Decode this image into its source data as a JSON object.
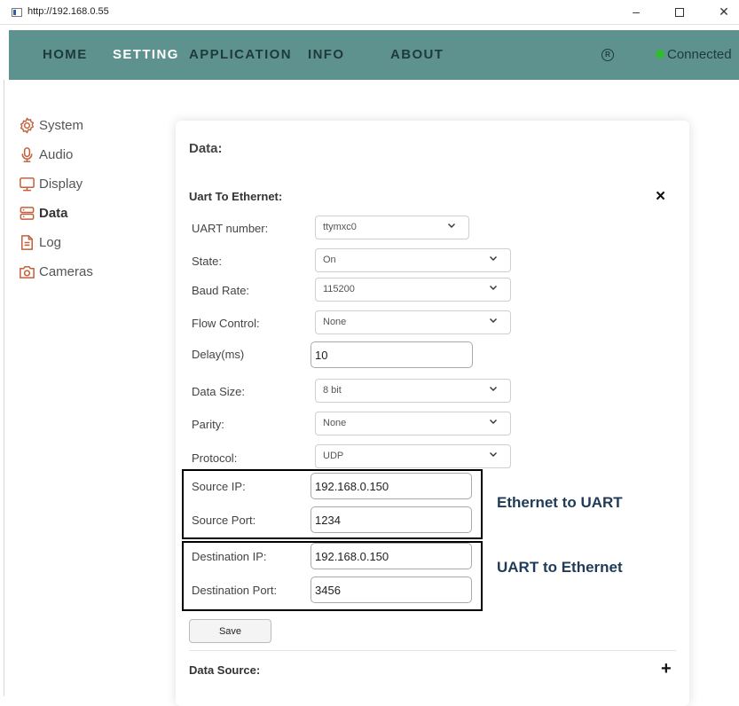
{
  "window": {
    "url": "http://192.168.0.55",
    "minimize": "–",
    "close": "✕"
  },
  "nav": {
    "items": [
      "HOME",
      "SETTING",
      "APPLICATION",
      "INFO",
      "ABOUT"
    ],
    "active": "SETTING",
    "reg_symbol": "R",
    "status": "Connected",
    "status_color": "#2fbd2f",
    "bar_color": "#5e928f"
  },
  "sidebar": {
    "items": [
      {
        "label": "System",
        "icon": "gear-icon"
      },
      {
        "label": "Audio",
        "icon": "microphone-icon"
      },
      {
        "label": "Display",
        "icon": "monitor-icon"
      },
      {
        "label": "Data",
        "icon": "database-icon"
      },
      {
        "label": "Log",
        "icon": "document-icon"
      },
      {
        "label": "Cameras",
        "icon": "camera-icon"
      }
    ],
    "active": "Data",
    "accent_color": "#c2603a"
  },
  "panel": {
    "title": "Data:",
    "section_title": "Uart To Ethernet:",
    "close_symbol": "×",
    "fields": {
      "uart_number": {
        "label": "UART number:",
        "value": "ttymxc0"
      },
      "state": {
        "label": "State:",
        "value": "On"
      },
      "baud_rate": {
        "label": "Baud Rate:",
        "value": "115200"
      },
      "flow_control": {
        "label": "Flow Control:",
        "value": "None"
      },
      "delay": {
        "label": "Delay(ms)",
        "value": "10"
      },
      "data_size": {
        "label": "Data Size:",
        "value": "8 bit"
      },
      "parity": {
        "label": "Parity:",
        "value": "None"
      },
      "protocol": {
        "label": "Protocol:",
        "value": "UDP"
      },
      "source_ip": {
        "label": "Source IP:",
        "value": "192.168.0.150"
      },
      "source_port": {
        "label": "Source Port:",
        "value": "1234"
      },
      "destination_ip": {
        "label": "Destination IP:",
        "value": "192.168.0.150"
      },
      "destination_port": {
        "label": "Destination Port:",
        "value": "3456"
      }
    },
    "save_label": "Save",
    "data_source_title": "Data Source:",
    "expand_symbol": "+"
  },
  "annotations": {
    "source_box_label": "Ethernet to UART",
    "destination_box_label": "UART to Ethernet"
  }
}
